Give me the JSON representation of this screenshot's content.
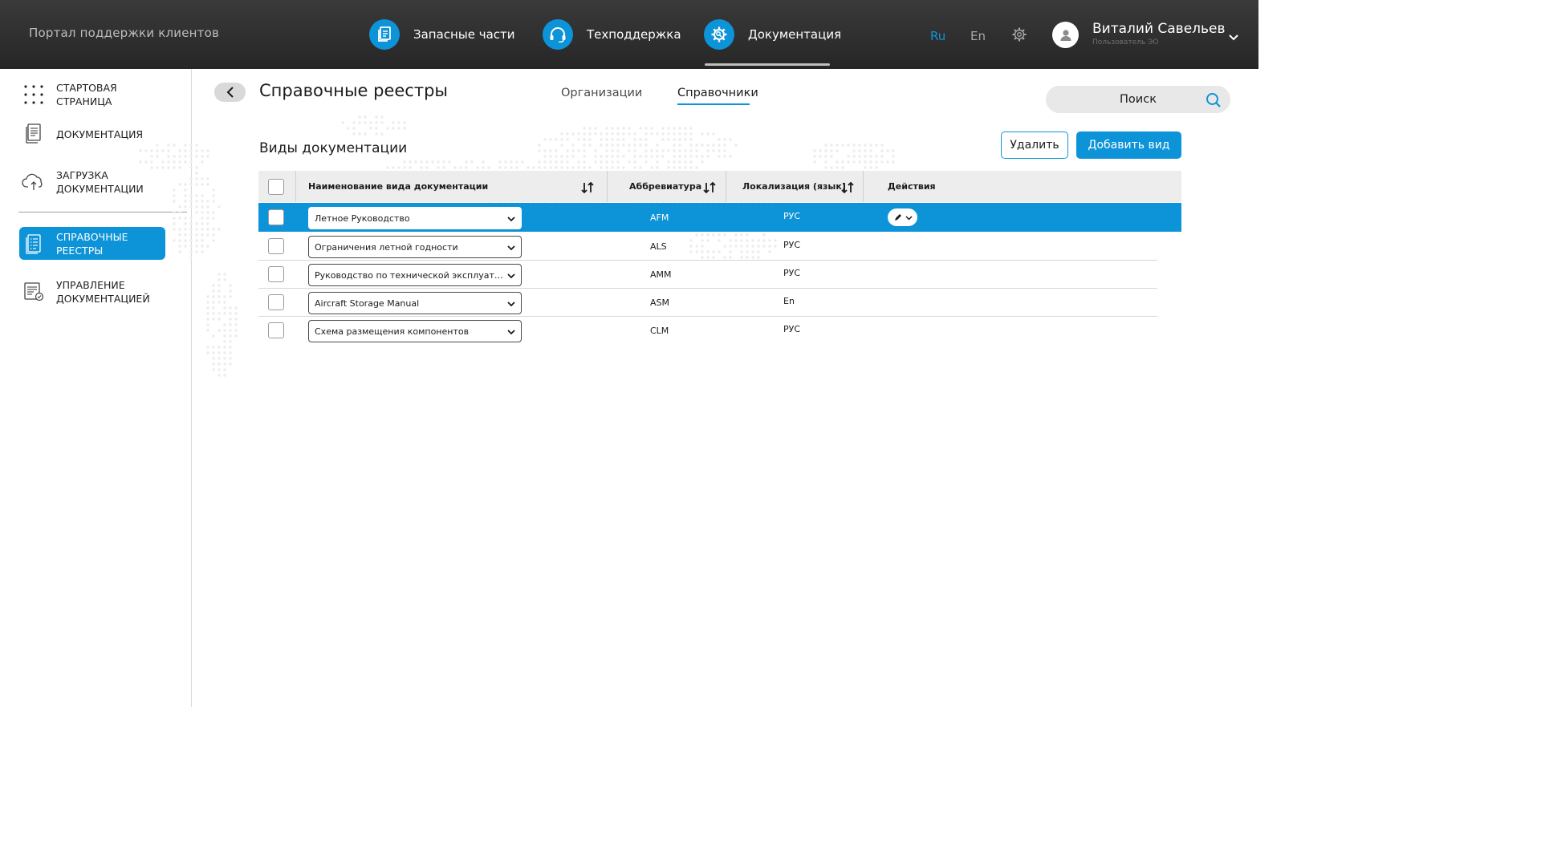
{
  "header": {
    "portal_title": "Портал поддержки клиентов",
    "nav": [
      {
        "label": "Запасные части",
        "icon": "document-icon"
      },
      {
        "label": "Техподдержка",
        "icon": "headset-icon"
      },
      {
        "label": "Документация",
        "icon": "gear-search-icon",
        "active": true
      }
    ],
    "lang_ru": "Ru",
    "lang_en": "En",
    "active_lang": "Ru",
    "user_name": "Виталий Савельев",
    "user_role": "Пользователь ЭО"
  },
  "sidebar": {
    "items": [
      {
        "label": "СТАРТОВАЯ СТРАНИЦА",
        "icon": "grid-dots-icon"
      },
      {
        "label": "ДОКУМЕНТАЦИЯ",
        "icon": "document-list-icon"
      },
      {
        "label": "ЗАГРУЗКА ДОКУМЕНТАЦИИ",
        "icon": "cloud-upload-icon"
      },
      {
        "label": "СПРАВОЧНЫЕ РЕЕСТРЫ",
        "icon": "registry-list-icon",
        "active": true
      },
      {
        "label": "УПРАВЛЕНИЕ ДОКУМЕНТАЦИЕЙ",
        "icon": "doc-manage-icon"
      }
    ]
  },
  "main": {
    "title": "Справочные реестры",
    "tabs": [
      {
        "label": "Организации"
      },
      {
        "label": "Справочники",
        "active": true
      }
    ],
    "search_placeholder": "Поиск",
    "section_title": "Виды документации",
    "delete_label": "Удалить",
    "add_label": "Добавить вид",
    "columns": {
      "name": "Наименование вида документации",
      "abbr": "Аббревиатура",
      "loc": "Локализация (язык)",
      "actions": "Действия"
    },
    "rows": [
      {
        "name": "Летное Руководство",
        "abbr": "AFM",
        "loc": "РУС",
        "selected": true
      },
      {
        "name": "Ограничения летной годности",
        "abbr": "ALS",
        "loc": "РУС"
      },
      {
        "name": "Руководство по технической эксплуатации ВС",
        "abbr": "AMM",
        "loc": "РУС"
      },
      {
        "name": "Aircraft Storage Manual",
        "abbr": "ASM",
        "loc": "En"
      },
      {
        "name": "Схема размещения компонентов",
        "abbr": "CLM",
        "loc": "РУС"
      }
    ]
  },
  "colors": {
    "accent": "#0d93d8",
    "header_bg": "#2f2f2f",
    "table_header_bg": "#ededed"
  }
}
